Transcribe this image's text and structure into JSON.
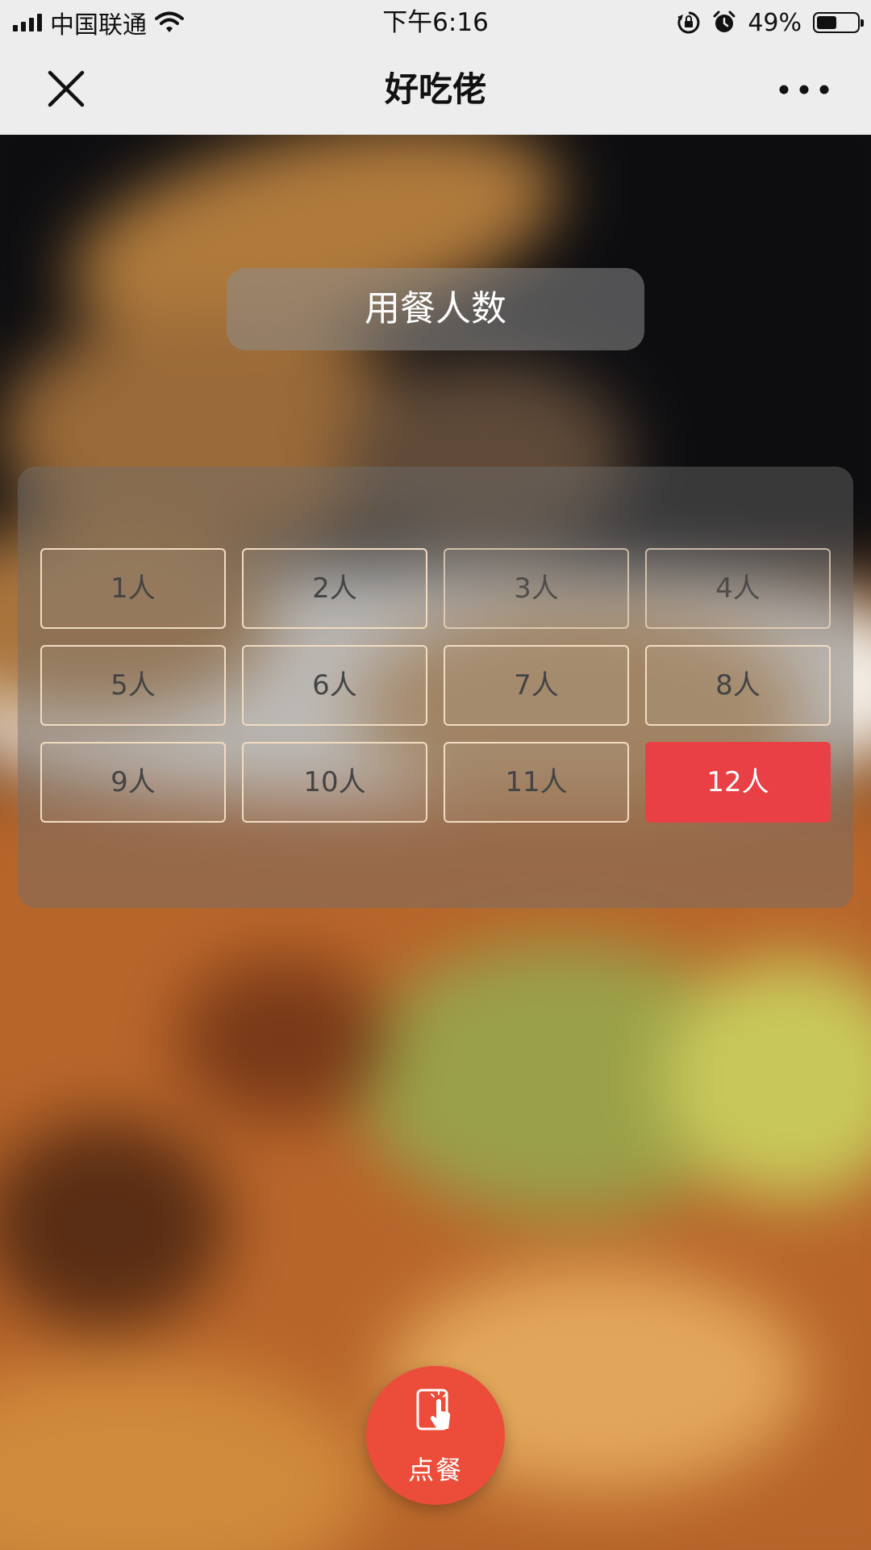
{
  "status_bar": {
    "carrier": "中国联通",
    "time": "下午6:16",
    "battery_text": "49%",
    "battery_level": 0.49,
    "icons": [
      "signal-icon",
      "wifi-icon",
      "orientation-lock-icon",
      "alarm-icon",
      "battery-icon"
    ]
  },
  "nav": {
    "title": "好吃佬",
    "close_icon": "close-icon",
    "more_icon": "more-dots-icon"
  },
  "selector": {
    "title": "用餐人数",
    "options": [
      "1人",
      "2人",
      "3人",
      "4人",
      "5人",
      "6人",
      "7人",
      "8人",
      "9人",
      "10人",
      "11人",
      "12人"
    ],
    "selected": "12人"
  },
  "order_button": {
    "label": "点餐",
    "icon": "tap-menu-icon"
  },
  "colors": {
    "accent": "#e94046",
    "order_button": "#ec4d3a",
    "option_border": "#f1dcc2",
    "bar_background": "#ededed"
  }
}
